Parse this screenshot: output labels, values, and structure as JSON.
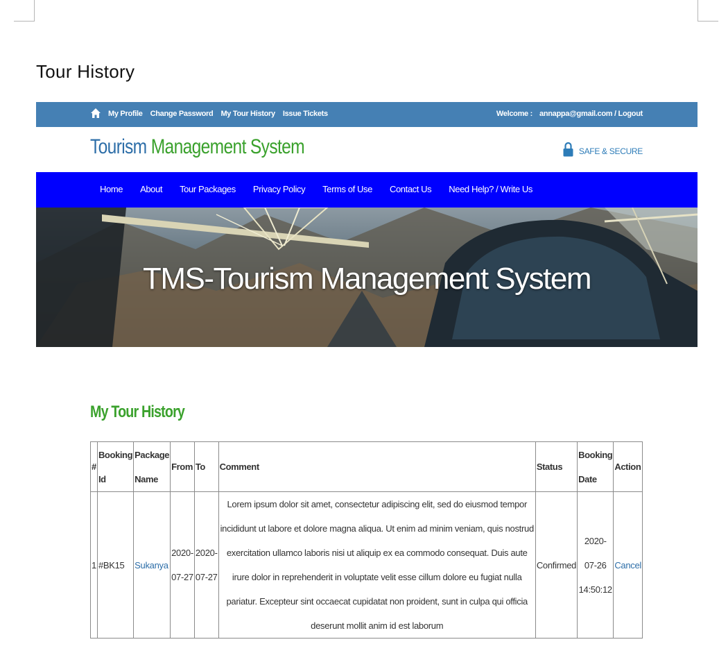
{
  "document": {
    "heading": "Tour History"
  },
  "topbar": {
    "nav": [
      "My Profile",
      "Change Password",
      "My Tour History",
      "Issue Tickets"
    ],
    "welcome_label": "Welcome :",
    "welcome_user": "annappa@gmail.com / Logout"
  },
  "brand": {
    "logo_part1": "Tourism",
    "logo_part2": "Management System",
    "secure_label": "SAFE & SECURE"
  },
  "mainnav": {
    "items": [
      "Home",
      "About",
      "Tour Packages",
      "Privacy Policy",
      "Terms of Use",
      "Contact Us",
      "Need Help? / Write Us"
    ]
  },
  "banner": {
    "title": "TMS-Tourism Management System"
  },
  "history": {
    "title": "My Tour History",
    "columns": [
      "#",
      "Booking Id",
      "Package Name",
      "From",
      "To",
      "Comment",
      "Status",
      "Booking Date",
      "Action"
    ],
    "rows": [
      {
        "num": "1",
        "booking_id": "#BK15",
        "package": "Sukanya",
        "from": "2020-07-27",
        "to": "2020-07-27",
        "comment": "Lorem ipsum dolor sit amet, consectetur adipiscing elit, sed do eiusmod tempor incididunt ut labore et dolore magna aliqua. Ut enim ad minim veniam, quis nostrud exercitation ullamco laboris nisi ut aliquip ex ea commodo consequat. Duis aute irure dolor in reprehenderit in voluptate velit esse cillum dolore eu fugiat nulla pariatur. Excepteur sint occaecat cupidatat non proident, sunt in culpa qui officia deserunt mollit anim id est laborum",
        "status": "Confirmed",
        "booking_date": "2020-07-26 14:50:12",
        "action": "Cancel"
      }
    ]
  },
  "colors": {
    "topbar": "#4580b4",
    "mainnav": "#0000ff",
    "logo_blue": "#2d6ea8",
    "logo_green": "#3aa12c"
  }
}
